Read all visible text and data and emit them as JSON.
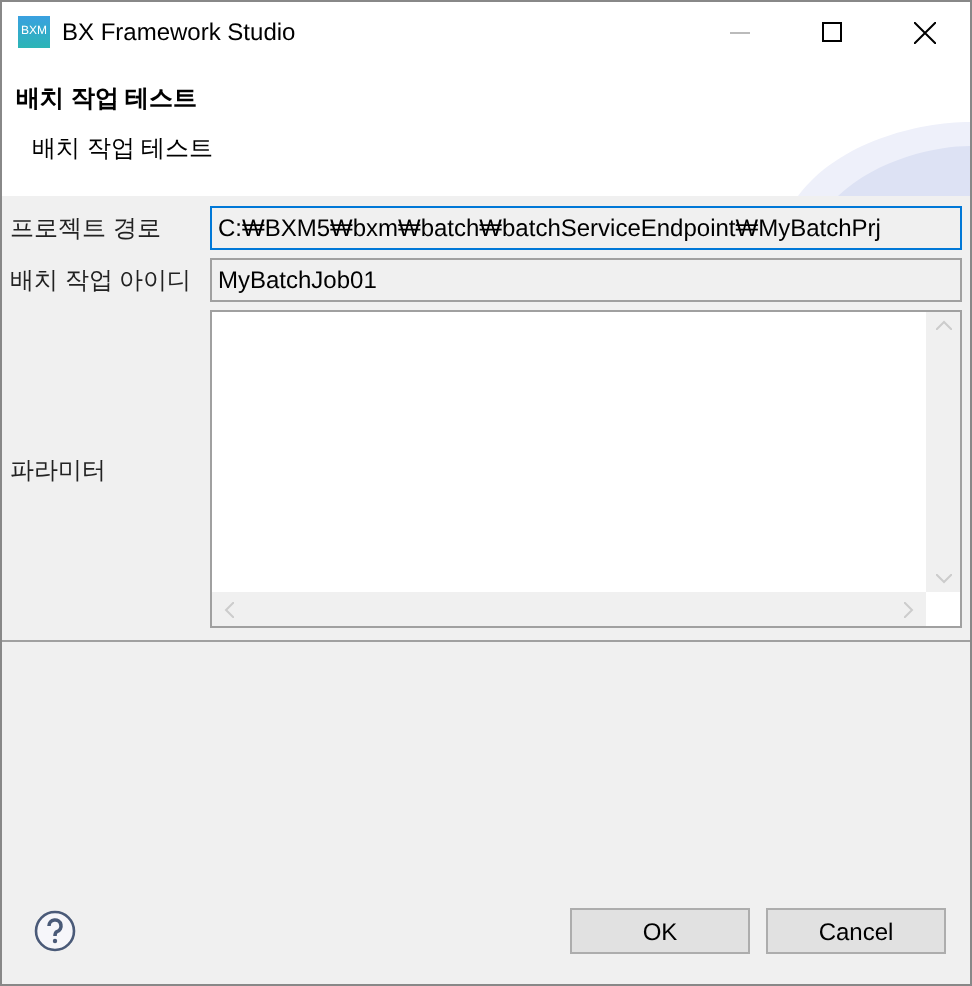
{
  "window": {
    "title": "BX Framework Studio",
    "logo": "BXM"
  },
  "header": {
    "title": "배치 작업 테스트",
    "description": "배치 작업 테스트"
  },
  "fields": [
    {
      "label": "프로젝트 경로",
      "value": "C:₩BXM5₩bxm₩batch₩batchServiceEndpoint₩MyBatchPrj",
      "focused": true
    },
    {
      "label": "배치 작업 아이디",
      "value": "MyBatchJob01",
      "focused": false
    }
  ],
  "parameters": {
    "label": "파라미터"
  },
  "buttons": [
    "OK",
    "Cancel"
  ]
}
